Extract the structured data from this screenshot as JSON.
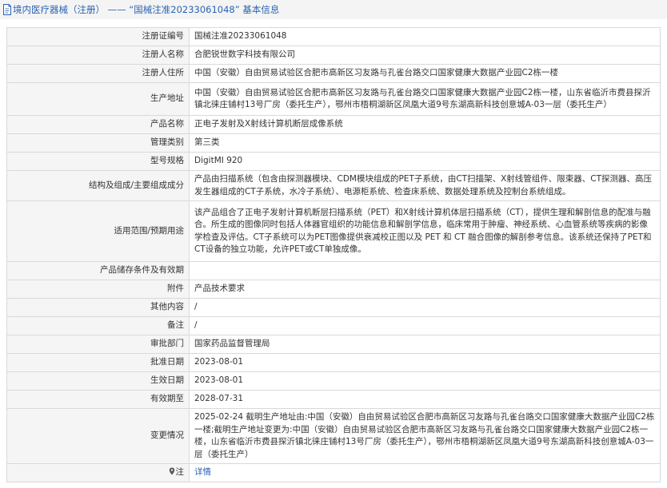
{
  "header": {
    "title": "境内医疗器械（注册） —— “国械注准20233061048” 基本信息"
  },
  "rows": [
    {
      "label": "注册证编号",
      "value": "国械注准20233061048"
    },
    {
      "label": "注册人名称",
      "value": "合肥锐世数字科技有限公司"
    },
    {
      "label": "注册人住所",
      "value": "中国（安徽）自由贸易试验区合肥市高新区习友路与孔雀台路交口国家健康大数据产业园C2栋一楼"
    },
    {
      "label": "生产地址",
      "value": "中国（安徽）自由贸易试验区合肥市高新区习友路与孔雀台路交口国家健康大数据产业园C2栋一楼，山东省临沂市费县探沂镇北徕庄铺村13号厂房（委托生产），鄂州市梧桐湖新区凤凰大道9号东湖高新科技创意城A-03一层（委托生产）"
    },
    {
      "label": "产品名称",
      "value": "正电子发射及X射线计算机断层成像系统"
    },
    {
      "label": "管理类别",
      "value": "第三类"
    },
    {
      "label": "型号规格",
      "value": "DigitMI 920"
    },
    {
      "label": "结构及组成/主要组成成分",
      "value": "产品由扫描系统（包含由探测器模块、CDM模块组成的PET子系统，由CT扫描架、X射线管组件、限束器、CT探测器、高压发生器组成的CT子系统，水冷子系统）、电源柜系统、检查床系统、数据处理系统及控制台系统组成。"
    },
    {
      "label": "适用范围/预期用途",
      "value": "该产品组合了正电子发射计算机断层扫描系统（PET）和X射线计算机体层扫描系统（CT），提供生理和解剖信息的配准与融合。所生成的图像同时包括人体器官组织的功能信息和解剖学信息，临床常用于肿瘤、神经系统、心血管系统等疾病的影像学检查及评估。CT子系统可以为PET图像提供衰减校正图以及 PET 和 CT 融合图像的解剖参考信息。该系统还保持了PET和CT设备的独立功能，允许PET或CT单独成像。"
    },
    {
      "label": "产品储存条件及有效期",
      "value": ""
    },
    {
      "label": "附件",
      "value": "产品技术要求"
    },
    {
      "label": "其他内容",
      "value": "/"
    },
    {
      "label": "备注",
      "value": "/"
    },
    {
      "label": "审批部门",
      "value": "国家药品监督管理局"
    },
    {
      "label": "批准日期",
      "value": "2023-08-01"
    },
    {
      "label": "生效日期",
      "value": "2023-08-01"
    },
    {
      "label": "有效期至",
      "value": "2028-07-31"
    },
    {
      "label": "变更情况",
      "value": "2025-02-24 截明生产地址由:中国（安徽）自由贸易试验区合肥市高新区习友路与孔雀台路交口国家健康大数据产业园C2栋一楼;截明生产地址变更为:中国（安徽）自由贸易试验区合肥市高新区习友路与孔雀台路交口国家健康大数据产业园C2栋一楼，山东省临沂市费县探沂镇北徕庄铺村13号厂房（委托生产），鄂州市梧桐湖新区凤凰大道9号东湖高新科技创意城A-03一层（委托生产）"
    }
  ],
  "footer_row": {
    "label": "注",
    "value": "详情"
  },
  "colors": {
    "link": "#2a63b2",
    "label_bg": "#f5f5f5",
    "border": "#d9d9d9"
  }
}
